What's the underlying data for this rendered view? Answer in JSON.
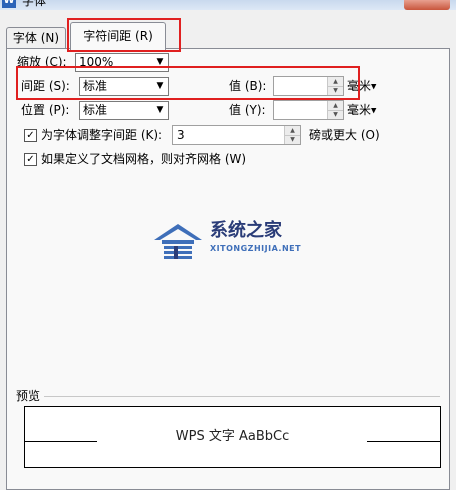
{
  "window": {
    "title": "字体",
    "icon": "W"
  },
  "tabs": [
    {
      "label": "字体 (N)"
    },
    {
      "label": "字符间距 (R)"
    }
  ],
  "scale": {
    "label": "缩放 (C):",
    "value": "100%"
  },
  "spacing": {
    "label": "间距 (S):",
    "value": "标准",
    "amount_label": "值 (B):",
    "amount_value": "",
    "unit": "毫米"
  },
  "position": {
    "label": "位置 (P):",
    "value": "标准",
    "amount_label": "值 (Y):",
    "amount_value": "",
    "unit": "毫米"
  },
  "kerning": {
    "label": "为字体调整字间距 (K):",
    "value": "3",
    "suffix": "磅或更大 (O)",
    "checked": true
  },
  "snap_grid": {
    "label": "如果定义了文档网格，则对齐网格 (W)",
    "checked": true
  },
  "watermark": {
    "title": "系统之家",
    "subtitle": "XITONGZHIJIA.NET"
  },
  "preview": {
    "label": "预览",
    "sample_text": "WPS 文字  AaBbCc"
  },
  "colors": {
    "highlight": "#e02020",
    "logo_blue": "#3f6fb9",
    "logo_navy": "#2a3c78"
  }
}
